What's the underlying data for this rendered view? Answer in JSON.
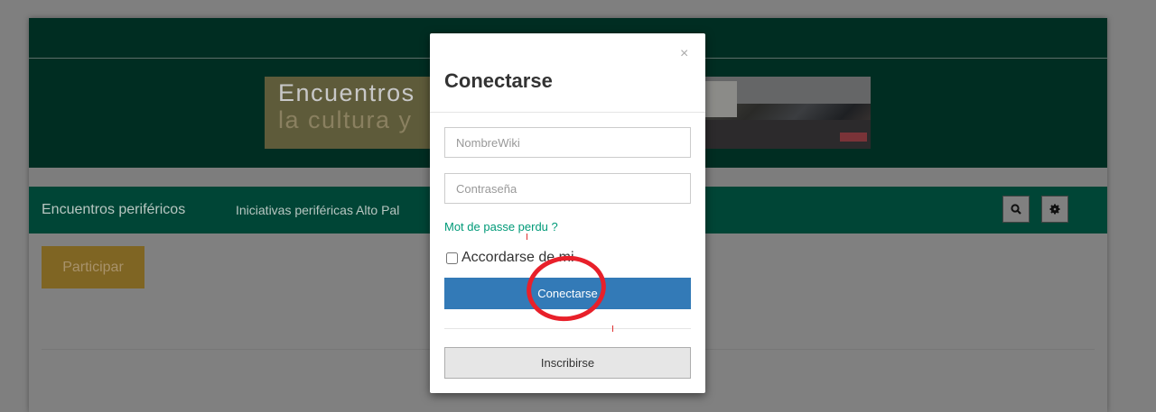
{
  "site": {
    "banner_title_line1": "Encuentros",
    "banner_title_line2": "la cultura y"
  },
  "navbar": {
    "brand": "Encuentros periféricos",
    "link": "Iniciativas periféricas Alto Pal",
    "search_icon": "search-icon",
    "settings_icon": "gear-icon"
  },
  "main": {
    "participar_label": "Participar"
  },
  "modal": {
    "close_label": "×",
    "title": "Conectarse",
    "username_placeholder": "NombreWiki",
    "password_placeholder": "Contraseña",
    "forgot_link": "Mot de passe perdu ?",
    "remember_label": "Accordarse de mi",
    "connect_button": "Conectarse",
    "signup_button": "Inscribirse"
  },
  "colors": {
    "nav": "#004536",
    "header": "#002d22",
    "primary_button": "#337ab7",
    "link": "#009a78",
    "annotation": "#e8202a"
  }
}
